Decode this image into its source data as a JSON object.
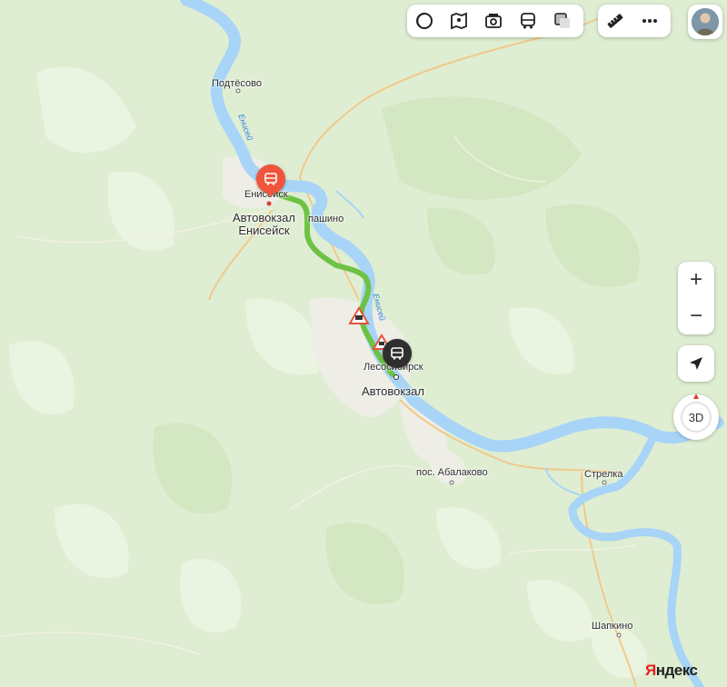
{
  "map": {
    "water_color": "#a8d4f7",
    "forest_color": "#dfeed2",
    "route_color": "#6dc244",
    "road_color": "#f0c98c"
  },
  "places": {
    "podtesovo": "Подтёсово",
    "eniseysk": "Енисейск",
    "pashino": "пашино",
    "lesosibirsk": "Лесосибирск",
    "abalakovo": "пос. Абалаково",
    "strelka": "Стрелка",
    "shapkino": "Шапкино"
  },
  "rivers": {
    "enisey_upper": "Енисей",
    "enisey_lower": "Енисей"
  },
  "route": {
    "start_label_line1": "Автовокзал",
    "start_label_line2": "Енисейск",
    "end_label": "Автовокзал",
    "start_pin_color": "#f0553b",
    "end_pin_color": "#2f2f2f"
  },
  "toolbar": {
    "layers_icon": "layers-icon",
    "panorama_icon": "panorama-icon",
    "photo_icon": "camera-icon",
    "transit_icon": "bus-icon",
    "copy_icon": "overlay-icon",
    "ruler_icon": "ruler-icon",
    "more_icon": "more-icon"
  },
  "controls": {
    "zoom_in": "+",
    "zoom_out": "−",
    "three_d": "3D"
  },
  "brand": {
    "logo_first": "Я",
    "logo_rest": "ндекс"
  }
}
